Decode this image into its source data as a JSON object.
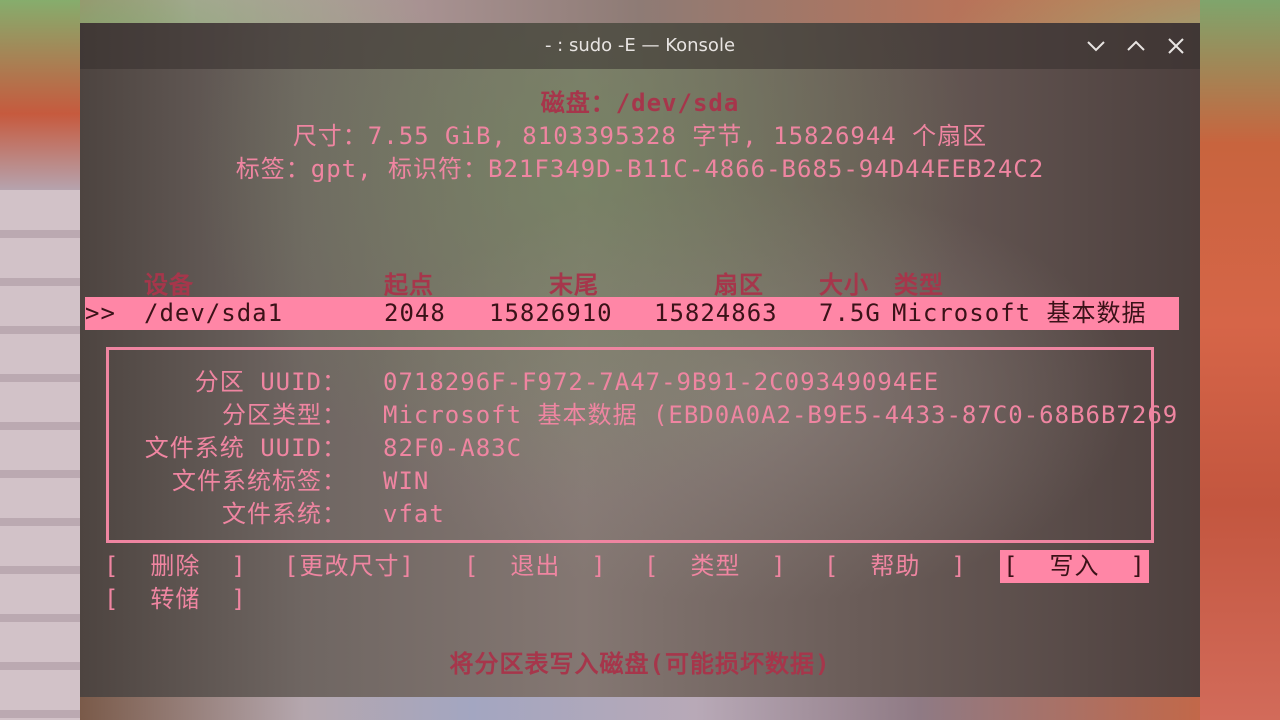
{
  "window": {
    "title": "- : sudo -E — Konsole"
  },
  "disk": {
    "heading": "磁盘：/dev/sda",
    "size_line": "尺寸：7.55 GiB, 8103395328 字节, 15826944 个扇区",
    "label_line": "标签：gpt, 标识符：B21F349D-B11C-4866-B685-94D44EEB24C2"
  },
  "table": {
    "headers": {
      "device": "设备",
      "start": "起点",
      "end": "末尾",
      "sectors": "扇区",
      "size": "大小",
      "type": "类型"
    },
    "rows": [
      {
        "marker": ">>",
        "device": "/dev/sda1",
        "start": "2048",
        "end": "15826910",
        "sectors": "15824863",
        "size": "7.5G",
        "type": "Microsoft 基本数据"
      }
    ]
  },
  "details": {
    "part_uuid_label": "分区 UUID：",
    "part_uuid": "0718296F-F972-7A47-9B91-2C09349094EE",
    "part_type_label": "分区类型：",
    "part_type": "Microsoft 基本数据 (EBD0A0A2-B9E5-4433-87C0-68B6B7269",
    "fs_uuid_label": "文件系统 UUID：",
    "fs_uuid": "82F0-A83C",
    "fs_label_label": "文件系统标签：",
    "fs_label": "WIN",
    "fs_label2": "文件系统：",
    "fs": "vfat"
  },
  "menu": {
    "delete": "[  删除  ]",
    "resize": "[更改尺寸]",
    "quit": "[  退出  ]",
    "type": "[  类型  ]",
    "help": "[  帮助  ]",
    "write": "[  写入  ]",
    "dump": "[  转储  ]",
    "selected": "write"
  },
  "status": {
    "hint": "将分区表写入磁盘(可能损坏数据)"
  },
  "colors": {
    "text": "#ef85a1",
    "dim": "#a6364b",
    "highlight_bg": "#ff86a6"
  }
}
